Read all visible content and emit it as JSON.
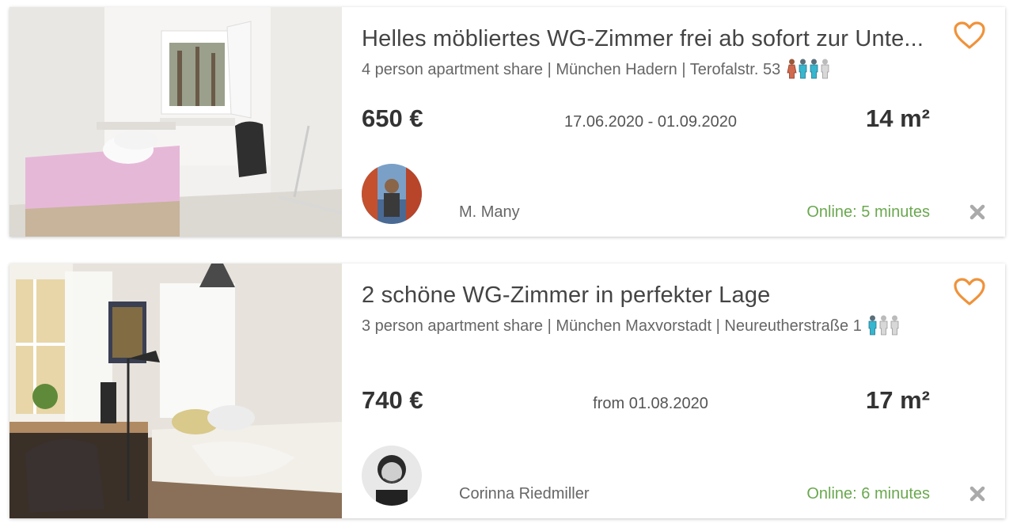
{
  "colors": {
    "accent": "#f0923a",
    "online": "#6aa84f",
    "close": "#aaaaaa"
  },
  "listings": [
    {
      "title": "Helles möbliertes WG-Zimmer frei ab sofort zur Unte...",
      "details": "4 person apartment share | München Hadern | Terofalstr. 53",
      "flatmates": [
        "female",
        "male",
        "male",
        "vacant"
      ],
      "price": "650 €",
      "dates": "17.06.2020 - 01.09.2020",
      "size": "14 m²",
      "user_name": "M. Many",
      "online": "Online: 5 minutes",
      "favorite_icon": "heart-outline-icon",
      "close_icon": "close-x-icon"
    },
    {
      "title": "2 schöne WG-Zimmer in perfekter Lage",
      "details": "3 person apartment share | München Maxvorstadt | Neureutherstraße 1",
      "flatmates": [
        "male",
        "vacant",
        "vacant"
      ],
      "price": "740 €",
      "dates": "from 01.08.2020",
      "size": "17 m²",
      "user_name": "Corinna Riedmiller",
      "online": "Online: 6 minutes",
      "favorite_icon": "heart-outline-icon",
      "close_icon": "close-x-icon"
    }
  ]
}
